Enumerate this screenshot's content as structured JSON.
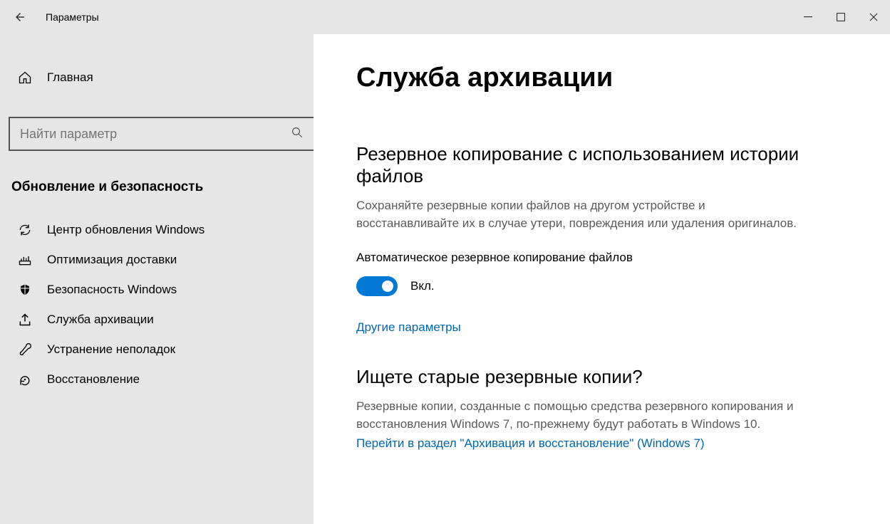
{
  "window": {
    "title": "Параметры"
  },
  "sidebar": {
    "home": "Главная",
    "search_placeholder": "Найти параметр",
    "category": "Обновление и безопасность",
    "items": [
      {
        "label": "Центр обновления Windows"
      },
      {
        "label": "Оптимизация доставки"
      },
      {
        "label": "Безопасность Windows"
      },
      {
        "label": "Служба архивации"
      },
      {
        "label": "Устранение неполадок"
      },
      {
        "label": "Восстановление"
      }
    ]
  },
  "main": {
    "title": "Служба архивации",
    "section1_heading": "Резервное копирование с использованием истории файлов",
    "section1_desc": "Сохраняйте резервные копии файлов на другом устройстве и восстанавливайте их в случае утери, повреждения или удаления оригиналов.",
    "toggle_label": "Автоматическое резервное копирование файлов",
    "toggle_state": "Вкл.",
    "more_options": "Другие параметры",
    "section2_heading": "Ищете старые резервные копии?",
    "section2_desc": "Резервные копии, созданные с помощью средства резервного копирования и восстановления Windows 7, по-прежнему будут работать в Windows 10.",
    "section2_link": "Перейти в раздел \"Архивация и восстановление\" (Windows 7)"
  }
}
